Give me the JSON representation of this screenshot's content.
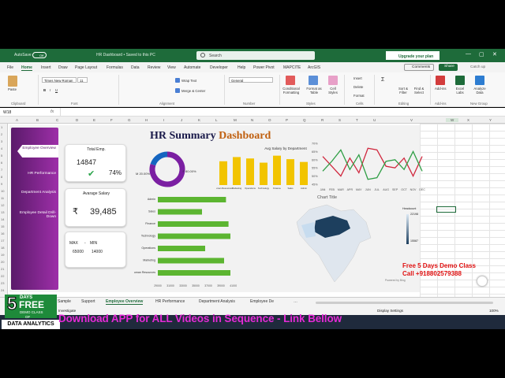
{
  "titlebar": {
    "autosave_label": "AutoSave",
    "autosave_state": "Off",
    "file_title": "HR Dashboard • Saved to this PC",
    "search_placeholder": "Search",
    "upgrade_label": "Upgrade your plan",
    "catchup": "Catch up"
  },
  "menu": {
    "items": [
      "File",
      "Home",
      "Insert",
      "Draw",
      "Page Layout",
      "Formulas",
      "Data",
      "Review",
      "View",
      "Automate",
      "Developer",
      "Help",
      "Power Pivot",
      "MAPCITE",
      "ArcGIS"
    ],
    "comments": "Comments",
    "share": "Share"
  },
  "ribbon": {
    "paste": "Paste",
    "font_name": "Times New Roman",
    "font_size": "11",
    "wrap_text": "Wrap Text",
    "merge": "Merge & Center",
    "number_format": "General",
    "cond_format": "Conditional Formatting",
    "format_table": "Format as Table",
    "cell_styles": "Cell Styles",
    "insert": "Insert",
    "delete": "Delete",
    "format": "Format",
    "sort_filter": "Sort & Filter",
    "find_select": "Find & Select",
    "addins": "Add-ins",
    "excel_labs": "Excel Labs",
    "analyze_data": "Analyze Data",
    "groups": [
      "Clipboard",
      "Font",
      "Alignment",
      "Number",
      "Styles",
      "Cells",
      "Editing",
      "Add-ins",
      "New Group"
    ]
  },
  "namebox": "W18",
  "columns": [
    "A",
    "B",
    "C",
    "D",
    "E",
    "F",
    "G",
    "H",
    "I",
    "J",
    "K",
    "L",
    "M",
    "N",
    "O",
    "P",
    "Q",
    "R",
    "S",
    "T",
    "U",
    "V",
    "W",
    "X",
    "Y"
  ],
  "nav": {
    "items": [
      "Employee Overview",
      "HR Performance",
      "Department Analysis",
      "Employee Detail Drill-Down"
    ]
  },
  "dashboard": {
    "title_a": "HR Summary",
    "title_b": "Dashboard",
    "total_emp_label": "Total Emp.",
    "total_emp_value": "14847",
    "total_emp_pct": "74%",
    "avg_salary_label": "Avarage Salary",
    "avg_salary_currency": "₹",
    "avg_salary_value": "39,485",
    "max_label": "MAX",
    "min_label": "MIN",
    "max_value": "65000",
    "min_value": "14000",
    "donut_f": "F 80.00%",
    "donut_m": "M 20.00%"
  },
  "chart_data": [
    {
      "type": "pie",
      "title": "",
      "categories": [
        "F",
        "M"
      ],
      "values": [
        80,
        20
      ],
      "colors": [
        "#7b1fa2",
        "#1565c0"
      ]
    },
    {
      "type": "bar",
      "title": "Avg Salary by Department",
      "categories": [
        "Human Resources",
        "Marketing",
        "Operations",
        "Technology",
        "Finance",
        "Sales",
        "Admin"
      ],
      "values": [
        34000,
        40000,
        38000,
        32000,
        42000,
        37000,
        33000
      ],
      "color": "#f2c400"
    },
    {
      "type": "line",
      "title": "",
      "categories": [
        "JAN",
        "FEB",
        "MAR",
        "APR",
        "MAY",
        "JUN",
        "JUL",
        "AUG",
        "SEP",
        "OCT",
        "NOV",
        "DEC"
      ],
      "yticks": [
        "45%",
        "50%",
        "55%",
        "60%",
        "65%",
        "70%"
      ],
      "ylim": [
        45,
        70
      ],
      "series": [
        {
          "values": [
            62,
            56,
            50,
            61,
            52,
            67,
            66,
            56,
            55,
            61,
            50,
            62
          ],
          "color": "#d0283e"
        },
        {
          "values": [
            53,
            59,
            66,
            54,
            63,
            48,
            49,
            59,
            60,
            54,
            65,
            53
          ],
          "color": "#2e9e44"
        }
      ]
    },
    {
      "type": "bar",
      "orientation": "horizontal",
      "title": "",
      "categories": [
        "Admin",
        "Sales",
        "Finance",
        "Technology",
        "Operations",
        "Marketing",
        "Human Resources"
      ],
      "values": [
        39800,
        36000,
        40200,
        40500,
        36500,
        39500,
        40500
      ],
      "xticks": [
        "29000",
        "31000",
        "33000",
        "35000",
        "37000",
        "39000",
        "41000"
      ],
      "xlim": [
        29000,
        41000
      ],
      "color": "#5cb531"
    }
  ],
  "map": {
    "title": "Chart Title",
    "legend_title": "Headcount",
    "legend_max": "22198",
    "legend_min": "15587",
    "credit": "Powered by Bing"
  },
  "promo": {
    "line1": "Free 5 Days  Demo Class",
    "line2": "Call +918802579388"
  },
  "sheet_tabs": [
    "Sample",
    "Support",
    "Employee Overview",
    "HR Performance",
    "Department Analysis",
    "Employee De"
  ],
  "active_tab": "Employee Overview",
  "status": {
    "left": "Investigate",
    "display": "Display Settings",
    "zoom": "100%"
  },
  "badge": {
    "days": "5",
    "days_label": "DAYS",
    "free": "FREE",
    "demo": "DEMO CLASS",
    "of": "OF",
    "subject": "DATA ANALYTICS"
  },
  "overlay_text": "Download APP for ALL Videos in Sequence - Link Bellow",
  "colors": {
    "excel_green": "#1e6b3a",
    "nav_purple": "#7b1fa2",
    "title_orange": "#c06010",
    "overlay_pink": "#e52ad7"
  }
}
